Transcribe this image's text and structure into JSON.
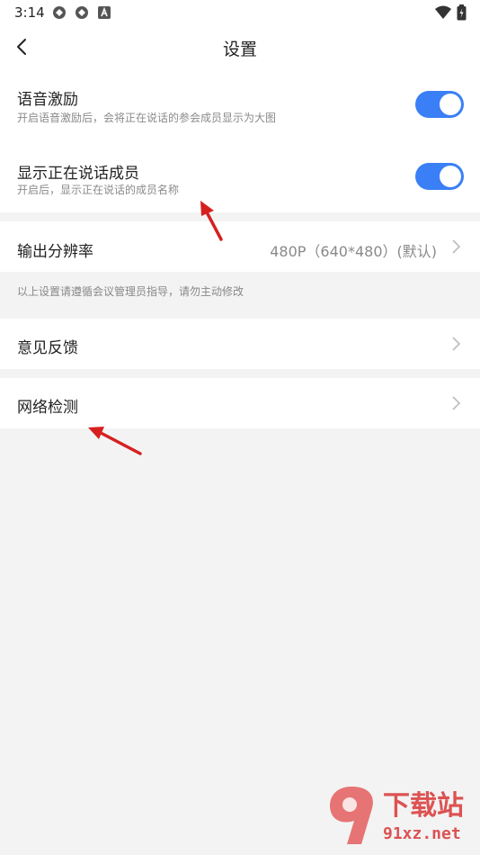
{
  "status_bar": {
    "time": "3:14",
    "icons": [
      "app-icon-1",
      "app-icon-2",
      "a-icon",
      "wifi-icon",
      "battery-icon"
    ]
  },
  "header": {
    "title": "设置",
    "back_icon": "chevron-left-icon"
  },
  "settings": {
    "voice_incentive": {
      "title": "语音激励",
      "subtitle": "开启语音激励后，会将正在说话的参会成员显示为大图",
      "enabled": true
    },
    "show_speaking": {
      "title": "显示正在说话成员",
      "subtitle": "开启后，显示正在说话的成员名称",
      "enabled": true
    },
    "resolution": {
      "title": "输出分辨率",
      "value": "480P（640*480）(默认)"
    },
    "note": "以上设置请遵循会议管理员指导，请勿主动修改",
    "feedback": {
      "title": "意见反馈"
    },
    "network": {
      "title": "网络检测"
    }
  },
  "watermark": {
    "text_main": "下载站",
    "text_url": "91xz.net"
  },
  "colors": {
    "accent": "#3a7ff6",
    "background": "#f3f3f3",
    "arrow": "#d62020"
  }
}
